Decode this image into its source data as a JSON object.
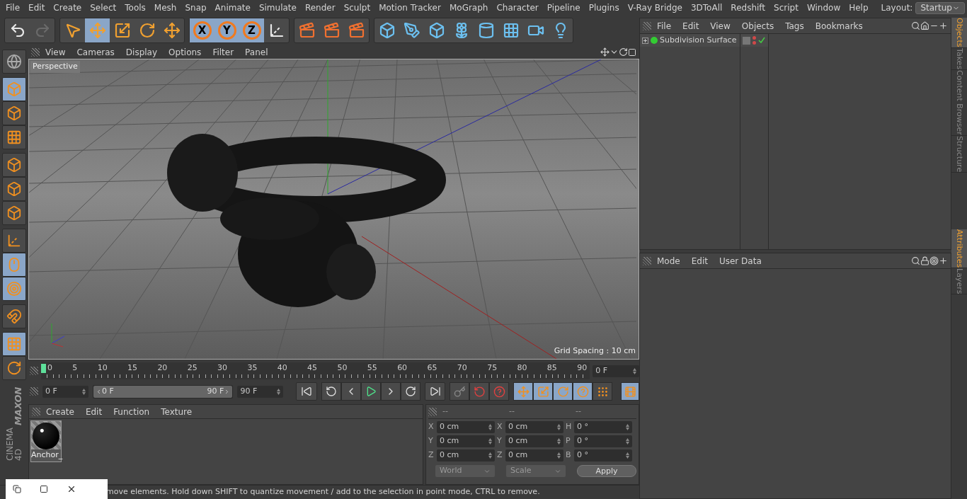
{
  "menu_bar": {
    "items": [
      "File",
      "Edit",
      "Create",
      "Select",
      "Tools",
      "Mesh",
      "Snap",
      "Animate",
      "Simulate",
      "Render",
      "Sculpt",
      "Motion Tracker",
      "MoGraph",
      "Character",
      "Pipeline",
      "Plugins",
      "V-Ray Bridge",
      "3DToAll",
      "Redshift",
      "Script",
      "Window",
      "Help"
    ],
    "layout_label": "Layout:",
    "layout_value": "Startup"
  },
  "toolbar": {
    "groups": [
      {
        "buttons": [
          {
            "selected": false,
            "disabled": false
          },
          {
            "selected": false,
            "disabled": true
          }
        ]
      },
      {
        "buttons": [
          {
            "selected": false,
            "disabled": false
          },
          {
            "selected": true,
            "disabled": false
          },
          {
            "selected": false,
            "disabled": false
          },
          {
            "selected": false,
            "disabled": false
          },
          {
            "selected": false,
            "disabled": false
          }
        ]
      },
      {
        "buttons": [
          {
            "label": "X",
            "selected": true,
            "disabled": false
          },
          {
            "label": "Y",
            "selected": true,
            "disabled": false
          },
          {
            "label": "Z",
            "selected": true,
            "disabled": false
          },
          {
            "selected": false,
            "disabled": false
          }
        ]
      },
      {
        "buttons": [
          {
            "selected": false,
            "disabled": false
          },
          {
            "selected": false,
            "disabled": false
          },
          {
            "selected": false,
            "disabled": false
          }
        ]
      },
      {
        "buttons": [
          {
            "selected": false,
            "disabled": false
          },
          {
            "selected": false,
            "disabled": false
          },
          {
            "selected": false,
            "disabled": false
          },
          {
            "selected": false,
            "disabled": false
          },
          {
            "selected": false,
            "disabled": false
          },
          {
            "selected": false,
            "disabled": false
          },
          {
            "selected": false,
            "disabled": false
          },
          {
            "selected": false,
            "disabled": false
          }
        ]
      }
    ]
  },
  "left_toolbar": {
    "groups": [
      {
        "buttons": [
          {
            "selected": false
          }
        ]
      },
      {
        "buttons": [
          {
            "selected": true
          },
          {
            "selected": false
          },
          {
            "selected": false
          }
        ]
      },
      {
        "buttons": [
          {
            "selected": false
          },
          {
            "selected": false
          },
          {
            "selected": false
          }
        ]
      },
      {
        "buttons": [
          {
            "selected": false
          },
          {
            "selected": true
          },
          {
            "selected": true
          }
        ]
      },
      {
        "buttons": [
          {
            "selected": false
          }
        ]
      },
      {
        "buttons": [
          {
            "selected": true
          },
          {
            "selected": false
          }
        ]
      }
    ],
    "logo_top": "MAXON",
    "logo_bottom": "CINEMA 4D"
  },
  "viewport": {
    "menu": [
      "View",
      "Cameras",
      "Display",
      "Options",
      "Filter",
      "Panel"
    ],
    "camera": "Perspective",
    "grid_spacing": "Grid Spacing : 10 cm"
  },
  "timeline": {
    "ticks": [
      "0",
      "5",
      "10",
      "15",
      "20",
      "25",
      "30",
      "35",
      "40",
      "45",
      "50",
      "55",
      "60",
      "65",
      "70",
      "75",
      "80",
      "85",
      "90"
    ],
    "level": 0,
    "current_frame": "0 F"
  },
  "playback": {
    "range": {
      "level": 1
    },
    "start": "0 F",
    "range_start": "0 F",
    "range_end": "90 F",
    "end": "90 F",
    "mode_buttons": [
      {
        "selected": true
      },
      {
        "selected": true
      },
      {
        "selected": true
      },
      {
        "selected": true
      },
      {
        "selected": false
      }
    ],
    "timeline_button": {
      "selected": true
    }
  },
  "material_manager": {
    "menu": [
      "Create",
      "Edit",
      "Function",
      "Texture"
    ],
    "materials": [
      {
        "name": "Anchor_"
      }
    ]
  },
  "coordinates": {
    "headers": [
      "--",
      "--",
      "--"
    ],
    "rows": [
      {
        "cells": [
          {
            "label": "X",
            "value": "0 cm"
          },
          {
            "label": "X",
            "value": "0 cm"
          },
          {
            "label": "H",
            "value": "0 °"
          }
        ]
      },
      {
        "cells": [
          {
            "label": "Y",
            "value": "0 cm"
          },
          {
            "label": "Y",
            "value": "0 cm"
          },
          {
            "label": "P",
            "value": "0 °"
          }
        ]
      },
      {
        "cells": [
          {
            "label": "Z",
            "value": "0 cm"
          },
          {
            "label": "Z",
            "value": "0 cm"
          },
          {
            "label": "B",
            "value": "0 °"
          }
        ]
      }
    ],
    "space": "World",
    "mode": "Scale",
    "apply": "Apply"
  },
  "status_bar": "move elements. Hold down SHIFT to quantize movement / add to the selection in point mode, CTRL to remove.",
  "object_manager": {
    "menu": [
      "File",
      "Edit",
      "View",
      "Objects",
      "Tags",
      "Bookmarks"
    ],
    "objects": [
      {
        "name": "Subdivision Surface",
        "expanded": false,
        "enabled": true
      }
    ]
  },
  "attribute_manager": {
    "menu": [
      "Mode",
      "Edit",
      "User Data"
    ]
  },
  "side_tabs_top": [
    {
      "label": "Objects",
      "selected": true
    },
    {
      "label": "Takes",
      "selected": false
    },
    {
      "label": "Content Browser",
      "selected": false
    },
    {
      "label": "Structure",
      "selected": false
    }
  ],
  "side_tabs_bottom": [
    {
      "label": "Attributes",
      "selected": true
    },
    {
      "label": "Layers",
      "selected": false
    }
  ]
}
